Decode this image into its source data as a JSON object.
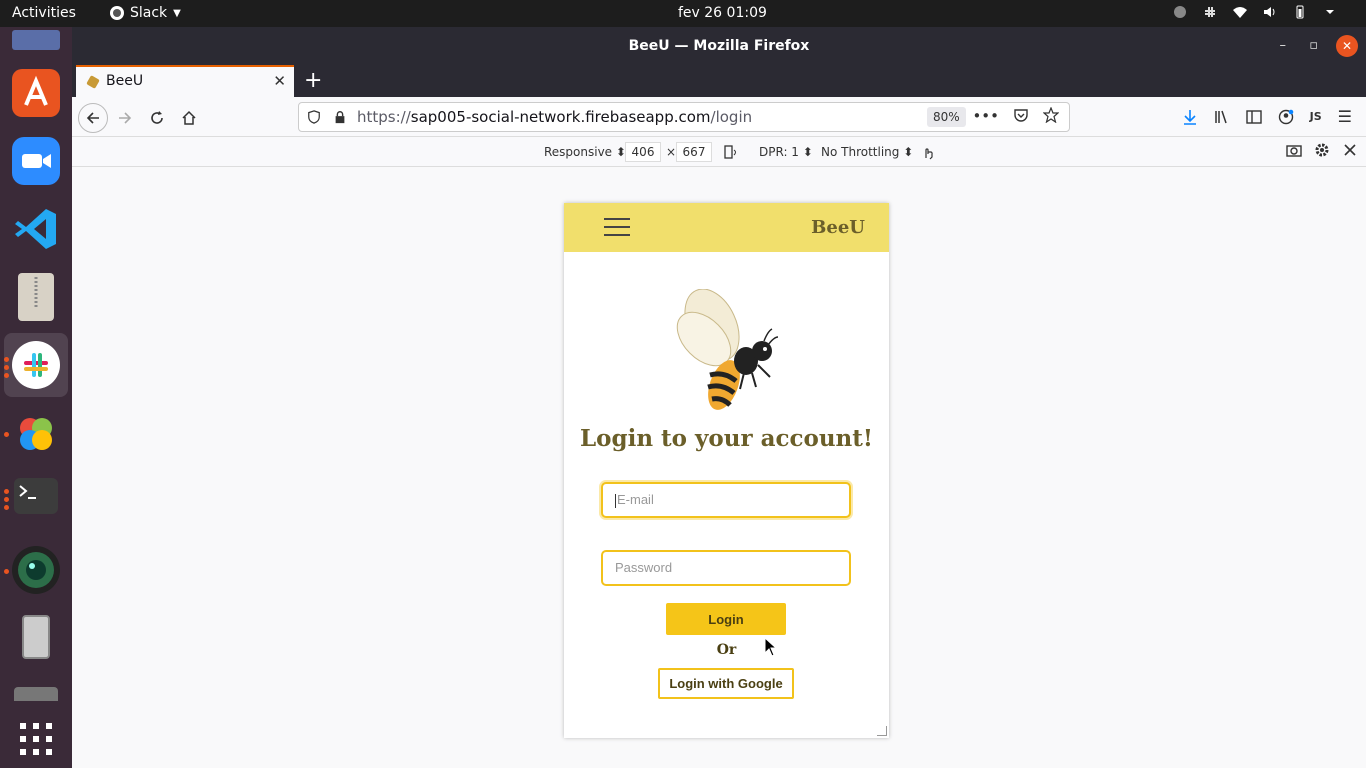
{
  "topbar": {
    "activities": "Activities",
    "app_menu": "Slack",
    "clock": "fev 26  01:09"
  },
  "window": {
    "title": "BeeU — Mozilla Firefox"
  },
  "tab": {
    "title": "BeeU"
  },
  "navbar": {
    "url_prefix": "https://",
    "url_host": "sap005-social-network.firebaseapp.com",
    "url_path": "/login",
    "zoom": "80%",
    "account_initials": "JS"
  },
  "rdm": {
    "device": "Responsive",
    "width": "406",
    "times": "×",
    "height": "667",
    "dpr": "DPR: 1",
    "throttling": "No Throttling"
  },
  "app": {
    "brand": "BeeU",
    "title": "Login to your account!",
    "email_placeholder": "E-mail",
    "password_placeholder": "Password",
    "login_button": "Login",
    "or": "Or",
    "google_button": "Login with Google"
  },
  "colors": {
    "header_bg": "#f1df6c",
    "accent": "#f5c518",
    "brand_text": "#6b5f2a"
  }
}
